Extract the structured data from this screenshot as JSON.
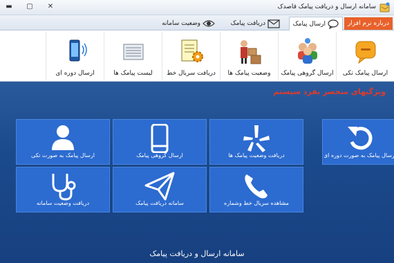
{
  "window": {
    "title": "سامانه ارسال و دریافت پیامک قاصدک",
    "app_icon": "app-logo-icon",
    "buttons": [
      "minimize-icon",
      "maximize-icon",
      "close-icon"
    ]
  },
  "tabs": {
    "about": "درباره نرم افزار",
    "send": "ارسال پیامک",
    "receive": "دریافت پیامک",
    "status": "وضعیت سامانه"
  },
  "ribbon": {
    "items": [
      {
        "label": "ارسال پیامک تکی",
        "icon": "chat-bubble-icon"
      },
      {
        "label": "ارسال گروهی پیامک",
        "icon": "group-people-icon"
      },
      {
        "label": "وضعیت پیامک ها",
        "icon": "courier-boxes-icon"
      },
      {
        "label": "دریافت سریال خط",
        "icon": "notepad-gear-icon"
      },
      {
        "label": "لیست پیامک ها",
        "icon": "inbox-list-icon"
      },
      {
        "label": "ارسال دوره ای",
        "icon": "mobile-signal-icon"
      }
    ]
  },
  "main": {
    "slogan": "ویژگیهای منحصر بفرد سیستم",
    "footer": "سامانه ارسال و دریافت پیامک"
  },
  "tiles": {
    "single": "ارسال پیامک به صورت تکی",
    "group": "ارسال گروهی پیامک",
    "status_sms": "دریافت وضعیت پیامک ها",
    "periodic": "ارسال پیامک به صورت دوره ای",
    "system_status": "دریافت وضعیت سامانه",
    "receive_sms": "سامانه دریافت پیامک",
    "serial": "مشاهده سریال خط وشماره"
  },
  "colors": {
    "tile_bg": "#2c6bd0",
    "main_bg": "#1b4a8c",
    "slogan": "#e23a2a",
    "about_tab": "#e9612a"
  }
}
